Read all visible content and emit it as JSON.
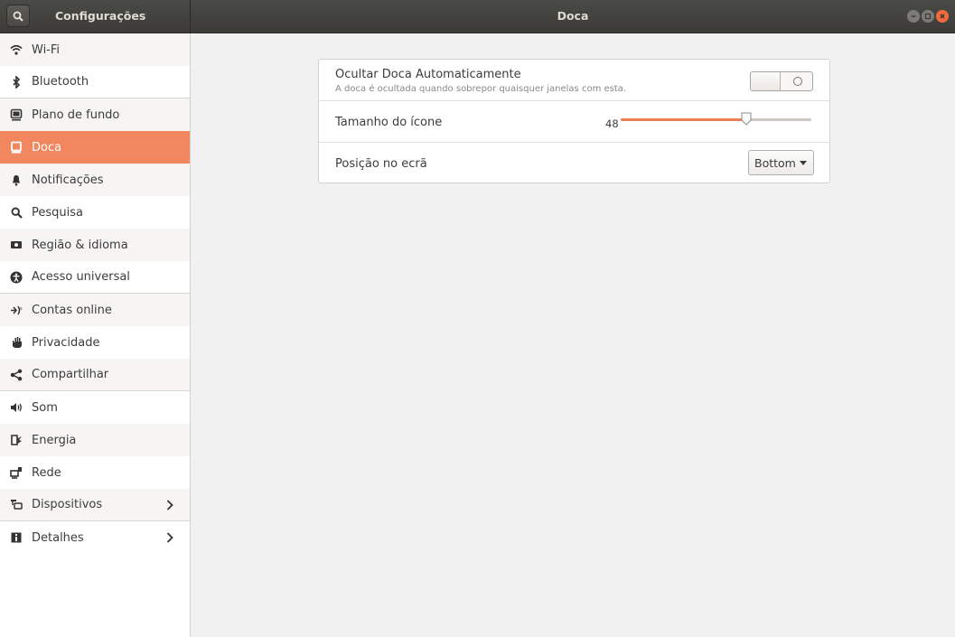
{
  "header": {
    "app_title": "Configurações",
    "window_title": "Doca"
  },
  "sidebar": {
    "items": [
      {
        "label": "Wi-Fi",
        "icon": "wifi-icon"
      },
      {
        "label": "Bluetooth",
        "icon": "bluetooth-icon"
      },
      {
        "label": "Plano de fundo",
        "icon": "background-icon"
      },
      {
        "label": "Doca",
        "icon": "dock-icon"
      },
      {
        "label": "Notificações",
        "icon": "bell-icon"
      },
      {
        "label": "Pesquisa",
        "icon": "search-icon"
      },
      {
        "label": "Região & idioma",
        "icon": "region-icon"
      },
      {
        "label": "Acesso universal",
        "icon": "accessibility-icon"
      },
      {
        "label": "Contas online",
        "icon": "online-accounts-icon"
      },
      {
        "label": "Privacidade",
        "icon": "hand-icon"
      },
      {
        "label": "Compartilhar",
        "icon": "share-icon"
      },
      {
        "label": "Som",
        "icon": "speaker-icon"
      },
      {
        "label": "Energia",
        "icon": "power-icon"
      },
      {
        "label": "Rede",
        "icon": "network-icon"
      },
      {
        "label": "Dispositivos",
        "icon": "devices-icon"
      },
      {
        "label": "Detalhes",
        "icon": "info-icon"
      }
    ],
    "active": "Doca"
  },
  "dock": {
    "autohide": {
      "title": "Ocultar Doca Automaticamente",
      "subtitle": "A doca é ocultada quando sobrepor quaisquer janelas com esta.",
      "enabled": false
    },
    "icon_size": {
      "title": "Tamanho do ícone",
      "value": "48",
      "fraction": 0.66
    },
    "position": {
      "title": "Posição no ecrã",
      "selected": "Bottom"
    }
  },
  "colors": {
    "accent": "#f0875e",
    "header_bg": "#3c3b37",
    "close": "#f16a3c"
  }
}
